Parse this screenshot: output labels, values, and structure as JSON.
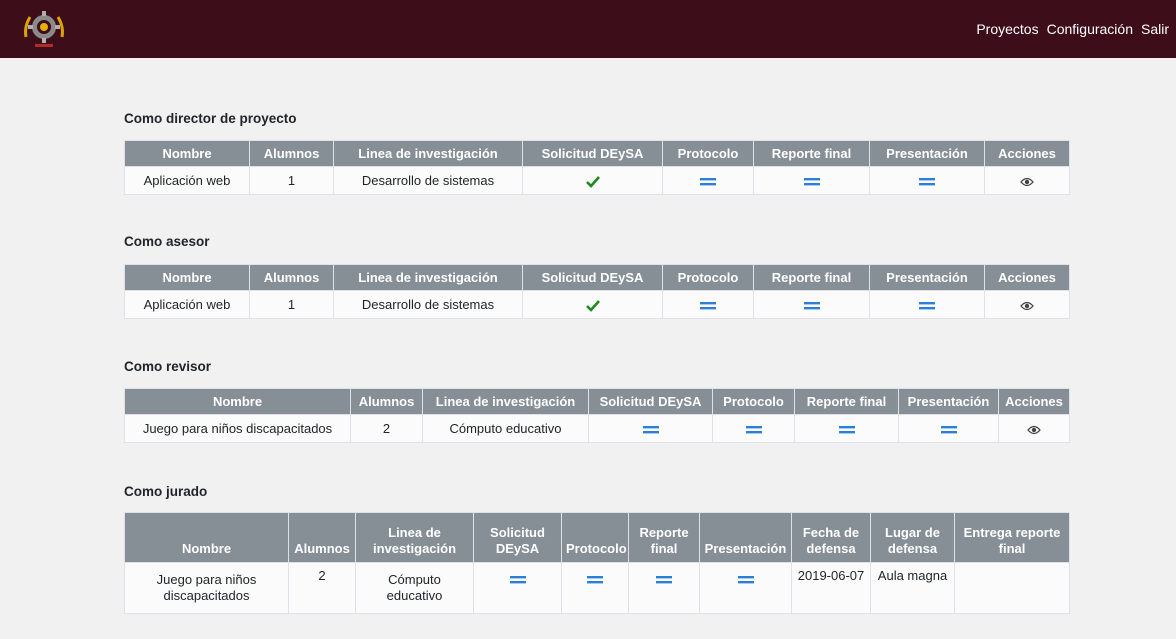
{
  "navbar": {
    "links": [
      "Proyectos",
      "Configuración",
      "Salir"
    ]
  },
  "colors": {
    "navbar": "#3d0d19",
    "header": "#868e96",
    "check": "#1e8a1e",
    "equals": "#2b7fd6"
  },
  "sections": [
    {
      "title": "Como director de proyecto",
      "headers": [
        "Nombre",
        "Alumnos",
        "Linea de investigación",
        "Solicitud DEySA",
        "Protocolo",
        "Reporte final",
        "Presentación",
        "Acciones"
      ],
      "row": {
        "nombre": "Aplicación web",
        "alumnos": "1",
        "linea": "Desarrollo de sistemas",
        "solicitud": "check-icon",
        "protocolo": "equals-icon",
        "reporte": "equals-icon",
        "presentacion": "equals-icon",
        "acciones": "eye-icon"
      }
    },
    {
      "title": "Como asesor",
      "headers": [
        "Nombre",
        "Alumnos",
        "Linea de investigación",
        "Solicitud DEySA",
        "Protocolo",
        "Reporte final",
        "Presentación",
        "Acciones"
      ],
      "row": {
        "nombre": "Aplicación web",
        "alumnos": "1",
        "linea": "Desarrollo de sistemas",
        "solicitud": "check-icon",
        "protocolo": "equals-icon",
        "reporte": "equals-icon",
        "presentacion": "equals-icon",
        "acciones": "eye-icon"
      }
    },
    {
      "title": "Como revisor",
      "headers": [
        "Nombre",
        "Alumnos",
        "Linea de investigación",
        "Solicitud DEySA",
        "Protocolo",
        "Reporte final",
        "Presentación",
        "Acciones"
      ],
      "row": {
        "nombre": "Juego para niños discapacitados",
        "alumnos": "2",
        "linea": "Cómputo educativo",
        "solicitud": "equals-icon",
        "protocolo": "equals-icon",
        "reporte": "equals-icon",
        "presentacion": "equals-icon",
        "acciones": "eye-icon"
      }
    },
    {
      "title": "Como jurado",
      "headers": [
        "Nombre",
        "Alumnos",
        "Linea de investigación",
        "Solicitud DEySA",
        "Protocolo",
        "Reporte final",
        "Presentación",
        "Fecha de defensa",
        "Lugar de defensa",
        "Entrega reporte final"
      ],
      "row": {
        "nombre": "Juego para niños discapacitados",
        "alumnos": "2",
        "linea": "Cómputo educativo",
        "solicitud": "equals-icon",
        "protocolo": "equals-icon",
        "reporte": "equals-icon",
        "presentacion": "equals-icon",
        "fecha": "2019-06-07",
        "lugar": "Aula magna",
        "entrega": ""
      }
    }
  ]
}
